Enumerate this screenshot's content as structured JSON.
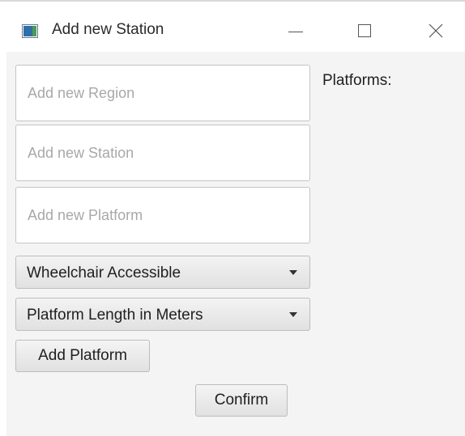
{
  "window": {
    "title": "Add new Station"
  },
  "form": {
    "region_placeholder": "Add new Region",
    "station_placeholder": "Add new Station",
    "platform_placeholder": "Add new Platform",
    "wheelchair_selected": "Wheelchair Accessible",
    "length_selected": "Platform Length in Meters",
    "add_platform_label": "Add Platform",
    "confirm_label": "Confirm"
  },
  "platforms": {
    "label": "Platforms:"
  },
  "icons": {
    "app": "java-app-icon",
    "minimize": "minimize-icon",
    "maximize": "maximize-icon",
    "close": "close-icon",
    "dropdown": "chevron-down-icon"
  }
}
